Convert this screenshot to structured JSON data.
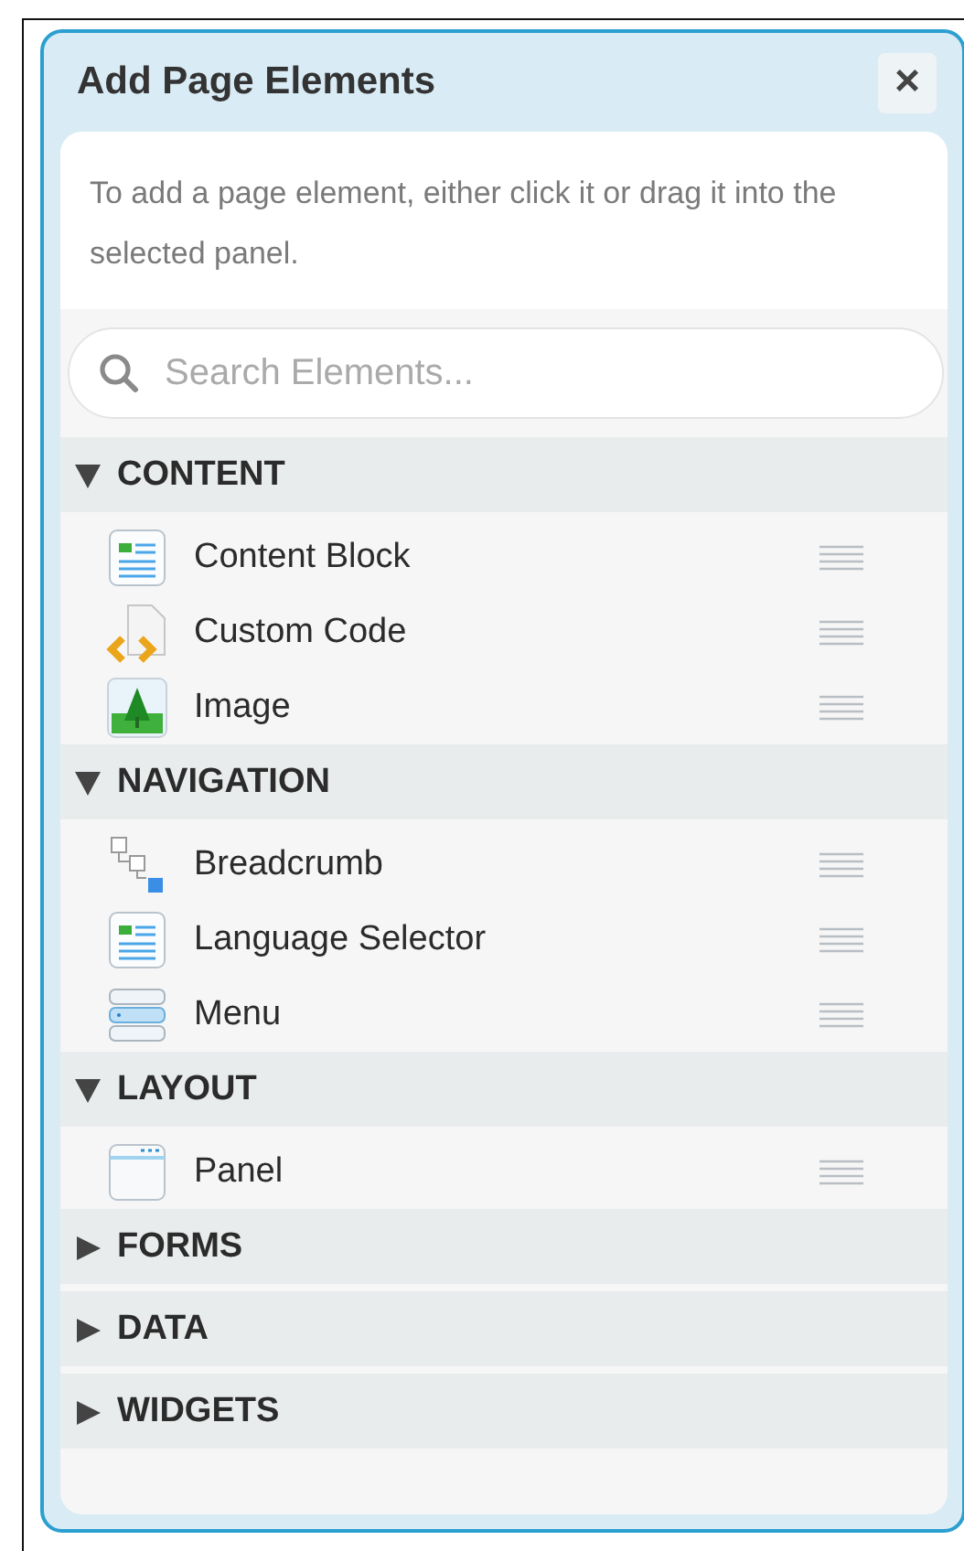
{
  "dialog": {
    "title": "Add Page Elements",
    "close": "×",
    "intro": "To add a page element, either click it or drag it into the selected panel.",
    "search": {
      "placeholder": "Search Elements..."
    },
    "sections": [
      {
        "label": "CONTENT",
        "expanded": true,
        "items": [
          {
            "label": "Content Block",
            "kind": "block"
          },
          {
            "label": "Custom Code",
            "kind": "code"
          },
          {
            "label": "Image",
            "kind": "image"
          }
        ]
      },
      {
        "label": "NAVIGATION",
        "expanded": true,
        "items": [
          {
            "label": "Breadcrumb",
            "kind": "tree"
          },
          {
            "label": "Language Selector",
            "kind": "block"
          },
          {
            "label": "Menu",
            "kind": "menu"
          }
        ]
      },
      {
        "label": "LAYOUT",
        "expanded": true,
        "items": [
          {
            "label": "Panel",
            "kind": "window"
          }
        ]
      },
      {
        "label": "FORMS",
        "expanded": false
      },
      {
        "label": "DATA",
        "expanded": false
      },
      {
        "label": "WIDGETS",
        "expanded": false
      }
    ]
  }
}
